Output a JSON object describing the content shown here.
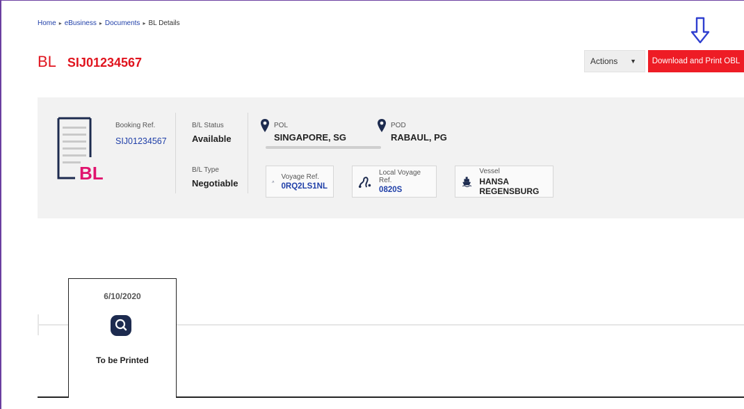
{
  "breadcrumb": {
    "items": [
      "Home",
      "eBusiness",
      "Documents"
    ],
    "current": "BL Details"
  },
  "header": {
    "prefix": "BL",
    "bl_number": "SIJ01234567",
    "actions_label": "Actions",
    "download_label": "Download and Print OBL"
  },
  "summary": {
    "icon_text": "BL",
    "booking_ref_label": "Booking Ref.",
    "booking_ref": "SIJ01234567",
    "bl_status_label": "B/L Status",
    "bl_status": "Available",
    "bl_type_label": "B/L Type",
    "bl_type": "Negotiable",
    "pol_label": "POL",
    "pol": "SINGAPORE, SG",
    "pod_label": "POD",
    "pod": "RABAUL, PG",
    "voyage_ref_label": "Voyage Ref.",
    "voyage_ref": "0RQ2LS1NL",
    "local_voyage_ref_label": "Local Voyage Ref.",
    "local_voyage_ref": "0820S",
    "vessel_label": "Vessel",
    "vessel": "HANSA REGENSBURG"
  },
  "timeline": {
    "date": "6/10/2020",
    "stage": "To be Printed"
  },
  "colors": {
    "accent_red": "#ee1c25",
    "link_blue": "#1f3fa8",
    "icon_navy": "#1d2b4f",
    "arrow_blue": "#2f3fcf",
    "bl_pink": "#e0146e"
  },
  "icons": [
    "arrow-down-icon",
    "document-bl-icon",
    "location-pin-icon",
    "voyage-route-icon",
    "ship-icon",
    "search-magnifier-icon"
  ]
}
